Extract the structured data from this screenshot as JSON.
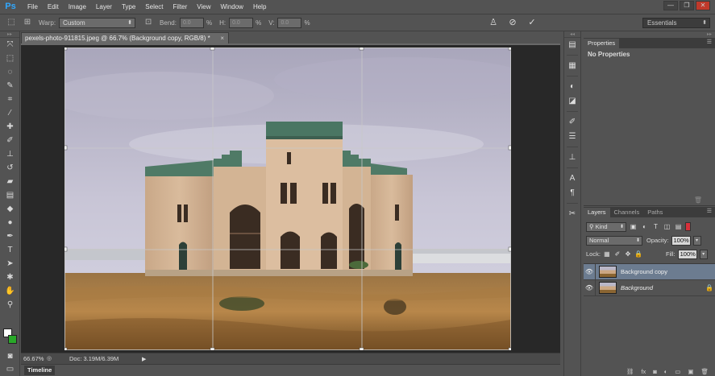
{
  "app": {
    "logo": "Ps",
    "menu": [
      "File",
      "Edit",
      "Image",
      "Layer",
      "Type",
      "Select",
      "Filter",
      "View",
      "Window",
      "Help"
    ],
    "window_controls": [
      "—",
      "❐",
      "✕"
    ]
  },
  "options_bar": {
    "warp_label": "Warp:",
    "warp_value": "Custom",
    "bend_label": "Bend:",
    "bend_value": "0.0",
    "h_label": "H:",
    "h_value": "0.0",
    "v_label": "V:",
    "v_value": "0.0",
    "pct": "%",
    "workspace": "Essentials"
  },
  "document": {
    "tab_title": "pexels-photo-911815.jpeg @ 66.7% (Background copy, RGB/8) *",
    "tab_close": "×",
    "zoom": "66.67%",
    "doc_info": "Doc: 3.19M/6.39M"
  },
  "timeline": {
    "label": "Timeline"
  },
  "properties": {
    "tab": "Properties",
    "body": "No Properties"
  },
  "layers_panel": {
    "tabs": [
      "Layers",
      "Channels",
      "Paths"
    ],
    "kind_label": "Kind",
    "blend_mode": "Normal",
    "opacity_label": "Opacity:",
    "opacity_value": "100%",
    "lock_label": "Lock:",
    "fill_label": "Fill:",
    "fill_value": "100%",
    "layers": [
      {
        "name": "Background copy",
        "visible": true,
        "selected": true
      },
      {
        "name": "Background",
        "visible": true,
        "selected": false,
        "locked": true
      }
    ]
  },
  "colors": {
    "foreground": "#ffffff",
    "background": "#29a829",
    "selection": "#6c7c90"
  },
  "tools": [
    "move-icon",
    "marquee-icon",
    "lasso-icon",
    "quick-select-icon",
    "crop-icon",
    "eyedropper-icon",
    "healing-brush-icon",
    "brush-icon",
    "clone-stamp-icon",
    "history-brush-icon",
    "eraser-icon",
    "gradient-icon",
    "blur-icon",
    "dodge-icon",
    "pen-icon",
    "type-icon",
    "path-select-icon",
    "shape-icon",
    "hand-icon",
    "zoom-icon"
  ]
}
